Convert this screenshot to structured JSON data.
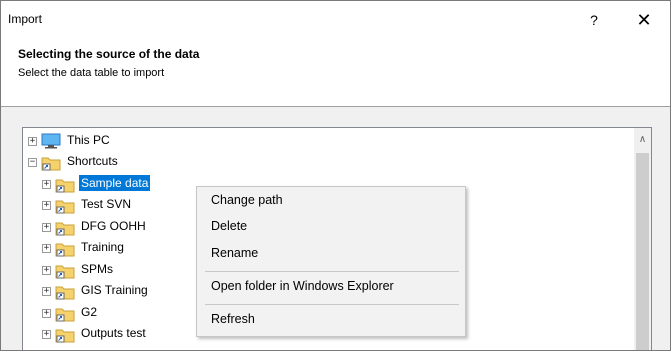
{
  "dialog": {
    "title": "Import",
    "help_glyph": "?",
    "close_glyph": "✕"
  },
  "header": {
    "title": "Selecting the source of the data",
    "subtitle": "Select the data table to import"
  },
  "tree": {
    "scroll_up_glyph": "∧",
    "items": [
      {
        "label": "This PC",
        "icon": "computer-icon",
        "level": 0,
        "expander": "+"
      },
      {
        "label": "Shortcuts",
        "icon": "shortcut-folder-icon",
        "level": 0,
        "expander": "−"
      },
      {
        "label": "Sample data",
        "icon": "shortcut-folder-icon",
        "level": 1,
        "expander": "+",
        "selected": true
      },
      {
        "label": "Test SVN",
        "icon": "shortcut-folder-icon",
        "level": 1,
        "expander": "+"
      },
      {
        "label": "DFG OOHH",
        "icon": "shortcut-folder-icon",
        "level": 1,
        "expander": "+"
      },
      {
        "label": "Training",
        "icon": "shortcut-folder-icon",
        "level": 1,
        "expander": "+"
      },
      {
        "label": "SPMs",
        "icon": "shortcut-folder-icon",
        "level": 1,
        "expander": "+"
      },
      {
        "label": "GIS Training",
        "icon": "shortcut-folder-icon",
        "level": 1,
        "expander": "+"
      },
      {
        "label": "G2",
        "icon": "shortcut-folder-icon",
        "level": 1,
        "expander": "+"
      },
      {
        "label": "Outputs test",
        "icon": "shortcut-folder-icon",
        "level": 1,
        "expander": "+"
      }
    ]
  },
  "context_menu": {
    "items": [
      {
        "label": "Change path"
      },
      {
        "label": "Delete"
      },
      {
        "label": "Rename"
      },
      {
        "label": "Open folder in Windows Explorer"
      },
      {
        "label": "Refresh"
      }
    ]
  },
  "colors": {
    "selection": "#0078d7",
    "folder": "#f5d26b",
    "dialog_bg": "#f0f0f0"
  }
}
